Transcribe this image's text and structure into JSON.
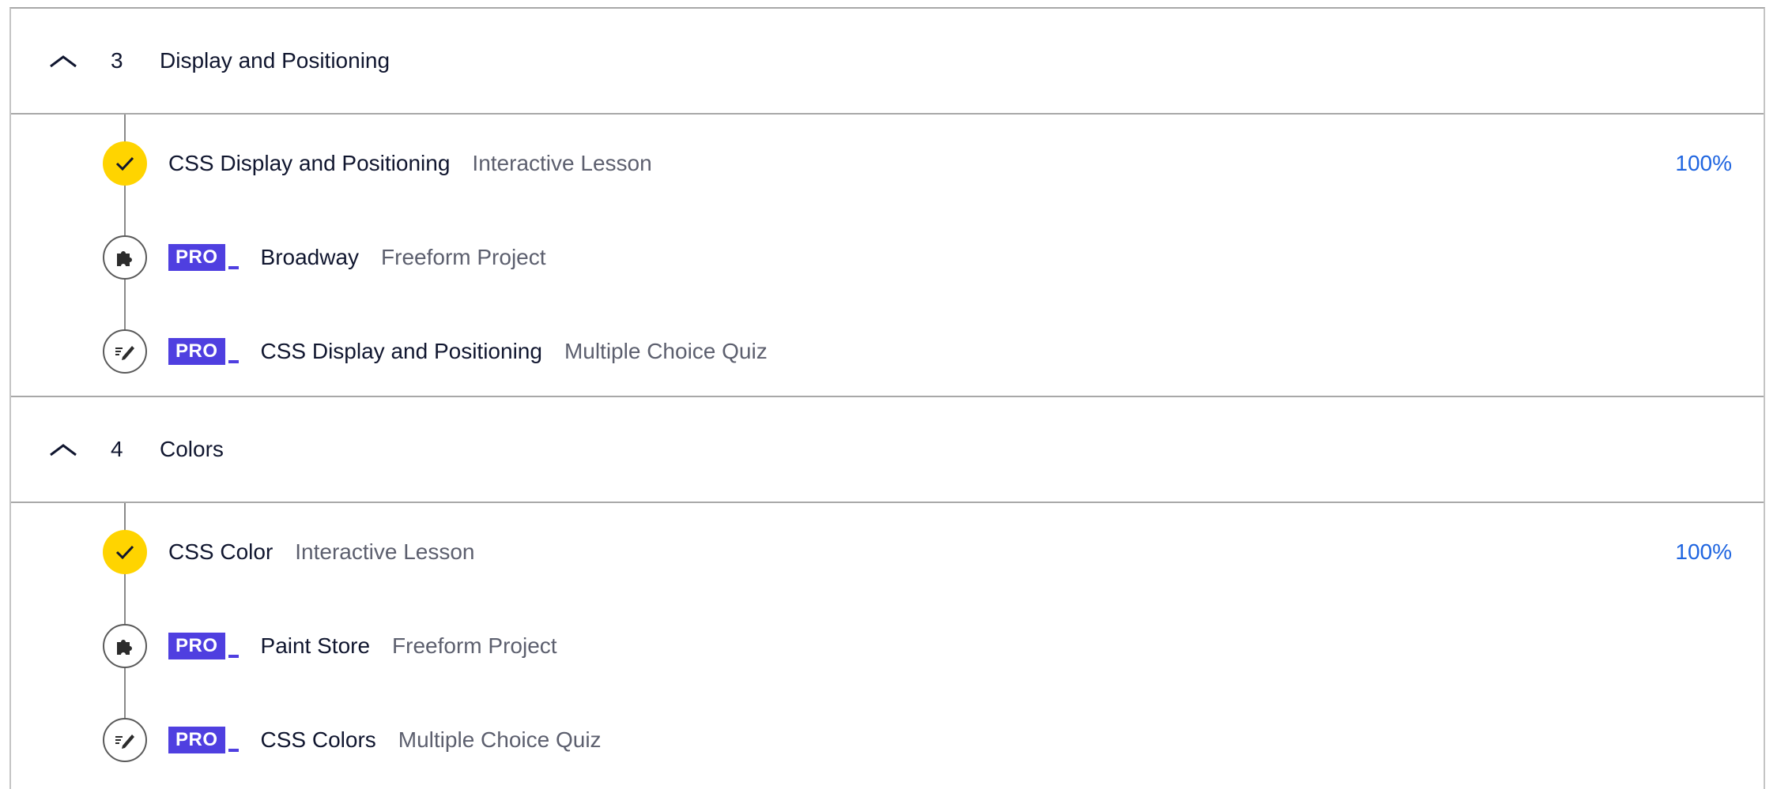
{
  "modules": [
    {
      "number": "3",
      "title": "Display and Positioning",
      "items": [
        {
          "title": "CSS Display and Positioning",
          "type": "Interactive Lesson",
          "status": "complete",
          "icon": "check-icon",
          "pro": false,
          "progress": "100%"
        },
        {
          "title": "Broadway",
          "type": "Freeform Project",
          "status": "incomplete",
          "icon": "puzzle-icon",
          "pro": true,
          "pro_label": "PRO"
        },
        {
          "title": "CSS Display and Positioning",
          "type": "Multiple Choice Quiz",
          "status": "incomplete",
          "icon": "quiz-pencil-icon",
          "pro": true,
          "pro_label": "PRO"
        }
      ]
    },
    {
      "number": "4",
      "title": "Colors",
      "items": [
        {
          "title": "CSS Color",
          "type": "Interactive Lesson",
          "status": "complete",
          "icon": "check-icon",
          "pro": false,
          "progress": "100%"
        },
        {
          "title": "Paint Store",
          "type": "Freeform Project",
          "status": "incomplete",
          "icon": "puzzle-icon",
          "pro": true,
          "pro_label": "PRO"
        },
        {
          "title": "CSS Colors",
          "type": "Multiple Choice Quiz",
          "status": "incomplete",
          "icon": "quiz-pencil-icon",
          "pro": true,
          "pro_label": "PRO"
        }
      ]
    }
  ],
  "colors": {
    "complete": "#ffd400",
    "pro": "#4f3fe0",
    "progress": "#1f65e0"
  }
}
